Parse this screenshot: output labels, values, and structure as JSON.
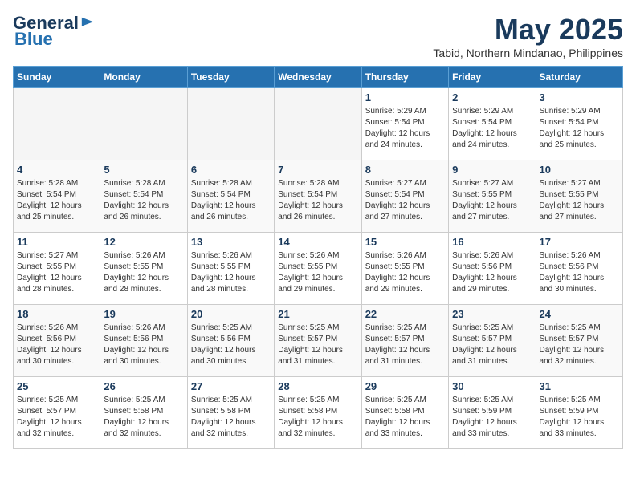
{
  "logo": {
    "general": "General",
    "blue": "Blue"
  },
  "title": "May 2025",
  "location": "Tabid, Northern Mindanao, Philippines",
  "weekdays": [
    "Sunday",
    "Monday",
    "Tuesday",
    "Wednesday",
    "Thursday",
    "Friday",
    "Saturday"
  ],
  "weeks": [
    [
      {
        "day": "",
        "info": ""
      },
      {
        "day": "",
        "info": ""
      },
      {
        "day": "",
        "info": ""
      },
      {
        "day": "",
        "info": ""
      },
      {
        "day": "1",
        "info": "Sunrise: 5:29 AM\nSunset: 5:54 PM\nDaylight: 12 hours\nand 24 minutes."
      },
      {
        "day": "2",
        "info": "Sunrise: 5:29 AM\nSunset: 5:54 PM\nDaylight: 12 hours\nand 24 minutes."
      },
      {
        "day": "3",
        "info": "Sunrise: 5:29 AM\nSunset: 5:54 PM\nDaylight: 12 hours\nand 25 minutes."
      }
    ],
    [
      {
        "day": "4",
        "info": "Sunrise: 5:28 AM\nSunset: 5:54 PM\nDaylight: 12 hours\nand 25 minutes."
      },
      {
        "day": "5",
        "info": "Sunrise: 5:28 AM\nSunset: 5:54 PM\nDaylight: 12 hours\nand 26 minutes."
      },
      {
        "day": "6",
        "info": "Sunrise: 5:28 AM\nSunset: 5:54 PM\nDaylight: 12 hours\nand 26 minutes."
      },
      {
        "day": "7",
        "info": "Sunrise: 5:28 AM\nSunset: 5:54 PM\nDaylight: 12 hours\nand 26 minutes."
      },
      {
        "day": "8",
        "info": "Sunrise: 5:27 AM\nSunset: 5:54 PM\nDaylight: 12 hours\nand 27 minutes."
      },
      {
        "day": "9",
        "info": "Sunrise: 5:27 AM\nSunset: 5:55 PM\nDaylight: 12 hours\nand 27 minutes."
      },
      {
        "day": "10",
        "info": "Sunrise: 5:27 AM\nSunset: 5:55 PM\nDaylight: 12 hours\nand 27 minutes."
      }
    ],
    [
      {
        "day": "11",
        "info": "Sunrise: 5:27 AM\nSunset: 5:55 PM\nDaylight: 12 hours\nand 28 minutes."
      },
      {
        "day": "12",
        "info": "Sunrise: 5:26 AM\nSunset: 5:55 PM\nDaylight: 12 hours\nand 28 minutes."
      },
      {
        "day": "13",
        "info": "Sunrise: 5:26 AM\nSunset: 5:55 PM\nDaylight: 12 hours\nand 28 minutes."
      },
      {
        "day": "14",
        "info": "Sunrise: 5:26 AM\nSunset: 5:55 PM\nDaylight: 12 hours\nand 29 minutes."
      },
      {
        "day": "15",
        "info": "Sunrise: 5:26 AM\nSunset: 5:55 PM\nDaylight: 12 hours\nand 29 minutes."
      },
      {
        "day": "16",
        "info": "Sunrise: 5:26 AM\nSunset: 5:56 PM\nDaylight: 12 hours\nand 29 minutes."
      },
      {
        "day": "17",
        "info": "Sunrise: 5:26 AM\nSunset: 5:56 PM\nDaylight: 12 hours\nand 30 minutes."
      }
    ],
    [
      {
        "day": "18",
        "info": "Sunrise: 5:26 AM\nSunset: 5:56 PM\nDaylight: 12 hours\nand 30 minutes."
      },
      {
        "day": "19",
        "info": "Sunrise: 5:26 AM\nSunset: 5:56 PM\nDaylight: 12 hours\nand 30 minutes."
      },
      {
        "day": "20",
        "info": "Sunrise: 5:25 AM\nSunset: 5:56 PM\nDaylight: 12 hours\nand 30 minutes."
      },
      {
        "day": "21",
        "info": "Sunrise: 5:25 AM\nSunset: 5:57 PM\nDaylight: 12 hours\nand 31 minutes."
      },
      {
        "day": "22",
        "info": "Sunrise: 5:25 AM\nSunset: 5:57 PM\nDaylight: 12 hours\nand 31 minutes."
      },
      {
        "day": "23",
        "info": "Sunrise: 5:25 AM\nSunset: 5:57 PM\nDaylight: 12 hours\nand 31 minutes."
      },
      {
        "day": "24",
        "info": "Sunrise: 5:25 AM\nSunset: 5:57 PM\nDaylight: 12 hours\nand 32 minutes."
      }
    ],
    [
      {
        "day": "25",
        "info": "Sunrise: 5:25 AM\nSunset: 5:57 PM\nDaylight: 12 hours\nand 32 minutes."
      },
      {
        "day": "26",
        "info": "Sunrise: 5:25 AM\nSunset: 5:58 PM\nDaylight: 12 hours\nand 32 minutes."
      },
      {
        "day": "27",
        "info": "Sunrise: 5:25 AM\nSunset: 5:58 PM\nDaylight: 12 hours\nand 32 minutes."
      },
      {
        "day": "28",
        "info": "Sunrise: 5:25 AM\nSunset: 5:58 PM\nDaylight: 12 hours\nand 32 minutes."
      },
      {
        "day": "29",
        "info": "Sunrise: 5:25 AM\nSunset: 5:58 PM\nDaylight: 12 hours\nand 33 minutes."
      },
      {
        "day": "30",
        "info": "Sunrise: 5:25 AM\nSunset: 5:59 PM\nDaylight: 12 hours\nand 33 minutes."
      },
      {
        "day": "31",
        "info": "Sunrise: 5:25 AM\nSunset: 5:59 PM\nDaylight: 12 hours\nand 33 minutes."
      }
    ]
  ]
}
